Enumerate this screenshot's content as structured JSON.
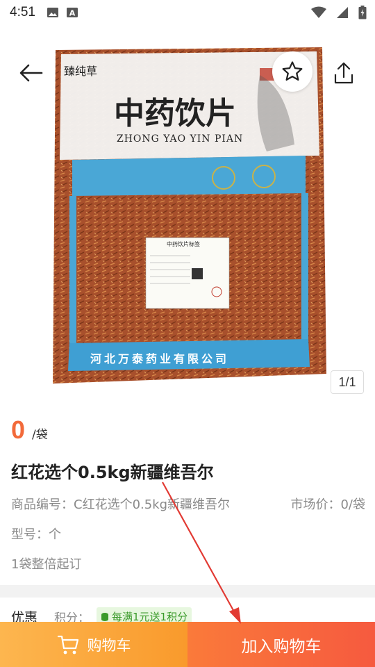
{
  "status_bar": {
    "time": "4:51",
    "left_icons": [
      "image-icon",
      "a-letter-icon"
    ],
    "right_icons": [
      "wifi-icon",
      "cell-signal-icon",
      "battery-charging-icon"
    ]
  },
  "gallery": {
    "page_indicator": "1/1",
    "bag_image": {
      "brand": "臻纯草",
      "title_cn": "中药饮片",
      "title_pinyin": "ZHONG YAO YIN PIAN",
      "label_title": "中药饮片标签",
      "manufacturer": "河北万泰药业有限公司"
    }
  },
  "product": {
    "price": "0",
    "unit": "/袋",
    "title": "红花选个0.5kg新疆维吾尔",
    "code": "商品编号：C红花选个0.5kg新疆维吾尔",
    "market_price": "市场价：0/袋",
    "model": "型号：个",
    "moq": "1袋整倍起订"
  },
  "promotion": {
    "label": "优惠",
    "sub_label": "积分：",
    "tag": "每满1元送1积分"
  },
  "bottom_bar": {
    "cart_label": "购物车",
    "add_label": "加入购物车"
  },
  "colors": {
    "price": "#f26a3a",
    "cart_button": "#f99a2c",
    "add_button": "#f65a3f",
    "annotation_arrow": "#e23a33"
  }
}
